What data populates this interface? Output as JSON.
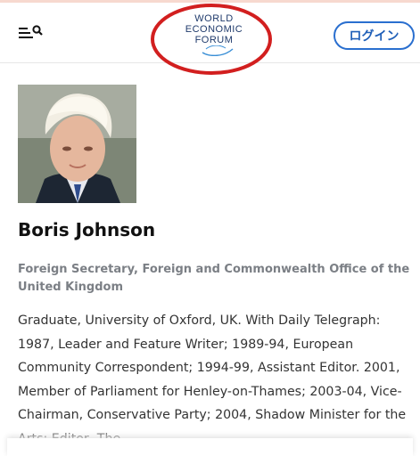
{
  "header": {
    "logo_lines": [
      "WORLD",
      "ECONOMIC",
      "FORUM"
    ],
    "login_label": "ログイン",
    "menu_icon": "menu-icon",
    "search_icon": "search-icon",
    "annotation_color": "#d21f1f"
  },
  "profile": {
    "name": "Boris Johnson",
    "role": "Foreign Secretary, Foreign and Commonwealth Office of the United Kingdom",
    "bio": "Graduate, University of Oxford, UK. With Daily Telegraph: 1987, Leader and Feature Writer; 1989-94, European Community Correspondent; 1994-99, Assistant Editor. 2001, Member of Parliament for Henley-on-Thames; 2003-04, Vice-Chairman, Conservative Party; 2004, Shadow Minister for the Arts; Editor, The"
  },
  "colors": {
    "brand": "#1f3a6b",
    "accent": "#2a6fcf",
    "role_text": "#7b7f85"
  }
}
